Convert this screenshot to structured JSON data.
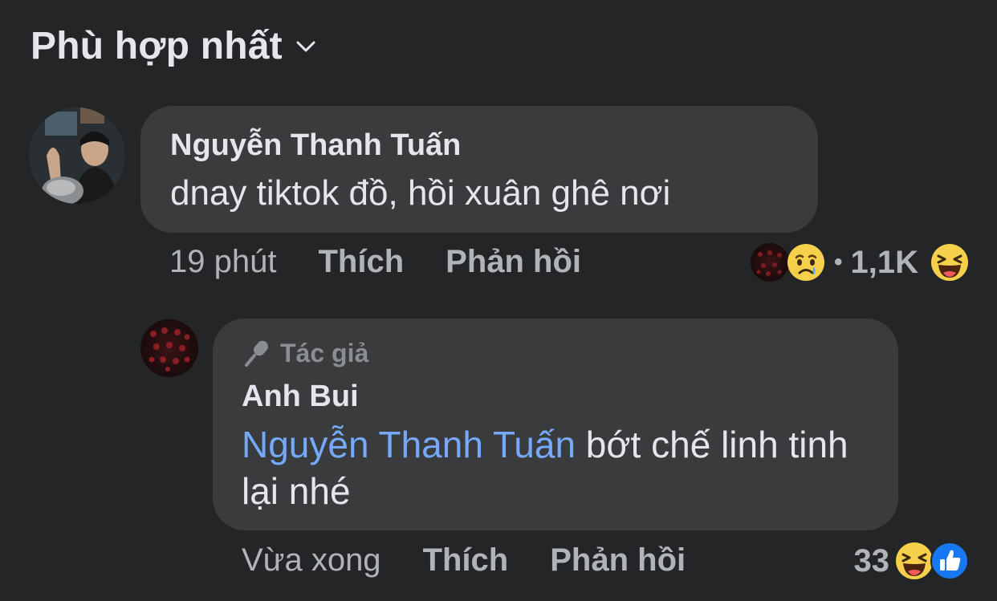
{
  "sort": {
    "label": "Phù hợp nhất",
    "icon": "chevron-down-icon"
  },
  "comment": {
    "author": "Nguyễn Thanh Tuấn",
    "text": "dnay tiktok đồ, hồi xuân ghê nơi",
    "time": "19 phút",
    "like_label": "Thích",
    "reply_label": "Phản hồi",
    "reactions": {
      "icons": [
        "sad-reaction-icon",
        "haha-reaction-icon"
      ],
      "count": "1,1K",
      "separator": "•"
    }
  },
  "reply": {
    "badge": "Tác giả",
    "badge_icon": "microphone-icon",
    "author": "Anh Bui",
    "mention": "Nguyễn Thanh Tuấn",
    "text": " bớt chế linh tinh lại nhé",
    "time": "Vừa xong",
    "like_label": "Thích",
    "reply_label": "Phản hồi",
    "reactions": {
      "count": "33",
      "icons": [
        "haha-reaction-icon",
        "like-reaction-icon"
      ]
    }
  },
  "colors": {
    "background": "#242526",
    "bubble": "#3a3b3c",
    "text_primary": "#e4e6eb",
    "text_secondary": "#b0b3b8",
    "mention": "#76a9fa",
    "like_blue": "#1877f2",
    "emoji_yellow": "#f7d04b"
  }
}
